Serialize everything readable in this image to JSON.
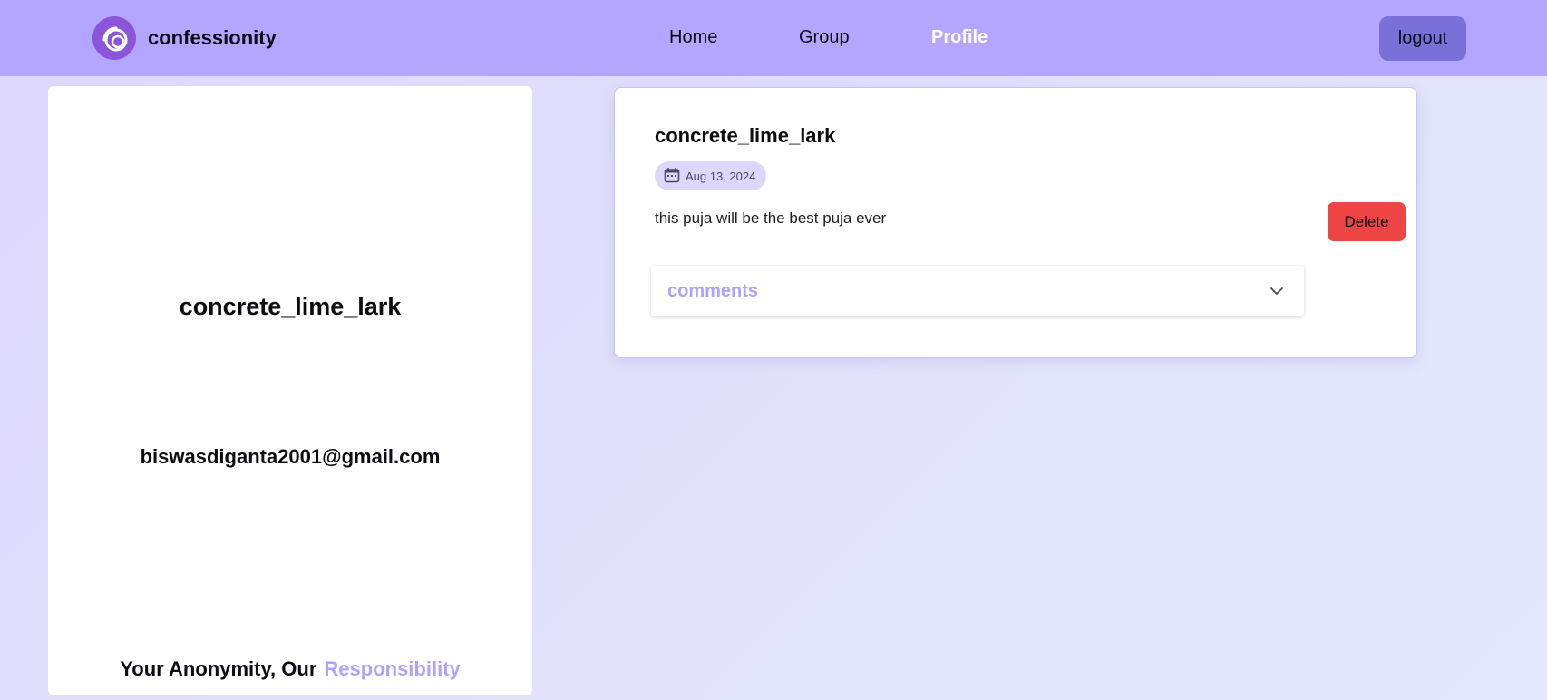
{
  "header": {
    "brand_name": "confessionity",
    "nav": [
      {
        "label": "Home",
        "active": false
      },
      {
        "label": "Group",
        "active": false
      },
      {
        "label": "Profile",
        "active": true
      }
    ],
    "logout_label": "logout"
  },
  "profile": {
    "username": "concrete_lime_lark",
    "email": "biswasdiganta2001@gmail.com",
    "tagline_prefix": "Your Anonymity, Our",
    "tagline_accent": "Responsibility"
  },
  "post": {
    "author": "concrete_lime_lark",
    "date": "Aug 13, 2024",
    "content": "this puja will be the best puja ever",
    "delete_label": "Delete",
    "comments_label": "comments"
  },
  "colors": {
    "navbar": "#b4a6fe",
    "logout": "#7b6fd9",
    "accent": "#b0a1fc",
    "delete": "#ef4444",
    "logo": "#8b55d9"
  },
  "icons": {
    "logo": "confessionity-logo-icon",
    "date": "calendar-icon",
    "comments_toggle": "chevron-down-icon"
  }
}
